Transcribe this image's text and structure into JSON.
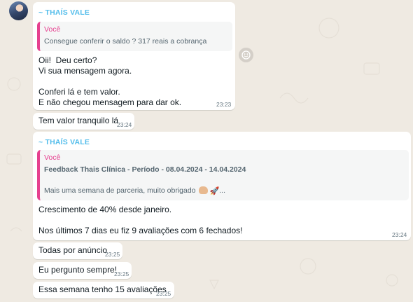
{
  "contact": {
    "sender_name": "~ THAÍS VALE"
  },
  "messages": {
    "m1": {
      "quote_author": "Você",
      "quote_text": "Consegue conferir o saldo ? 317 reais a cobrança",
      "lines": "Oii!  Deu certo?\nVi sua mensagem agora.\n\nConferi lá e tem valor.\nE não chegou mensagem para dar ok.",
      "time": "23:23"
    },
    "m2": {
      "text": "Tem valor tranquilo lá",
      "time": "23:24"
    },
    "m3": {
      "quote_author": "Você",
      "quote_title": "Feedback Thais Clínica - Período - 08.04.2024 - 14.04.2024",
      "quote_text": "Mais uma semana de parceria, muito obrigado",
      "quote_suffix": "...",
      "lines": "Crescimento de 40% desde janeiro.\n\nNos últimos 7 dias eu fiz 9 avaliações com 6 fechados!",
      "time": "23:24"
    },
    "m4": {
      "text": "Todas por anúncio",
      "time": "23:25"
    },
    "m5": {
      "text": "Eu pergunto sempre!",
      "time": "23:25"
    },
    "m6": {
      "text": "Essa semana tenho 15 avaliações",
      "time": "23:25"
    }
  },
  "icons": {
    "reaction": "smiley-icon",
    "emoji1": "fist-bump-emoji",
    "emoji2": "rocket-emoji"
  },
  "colors": {
    "background": "#efeae2",
    "sender": "#53bdeb",
    "quote_accent": "#e6408f"
  }
}
